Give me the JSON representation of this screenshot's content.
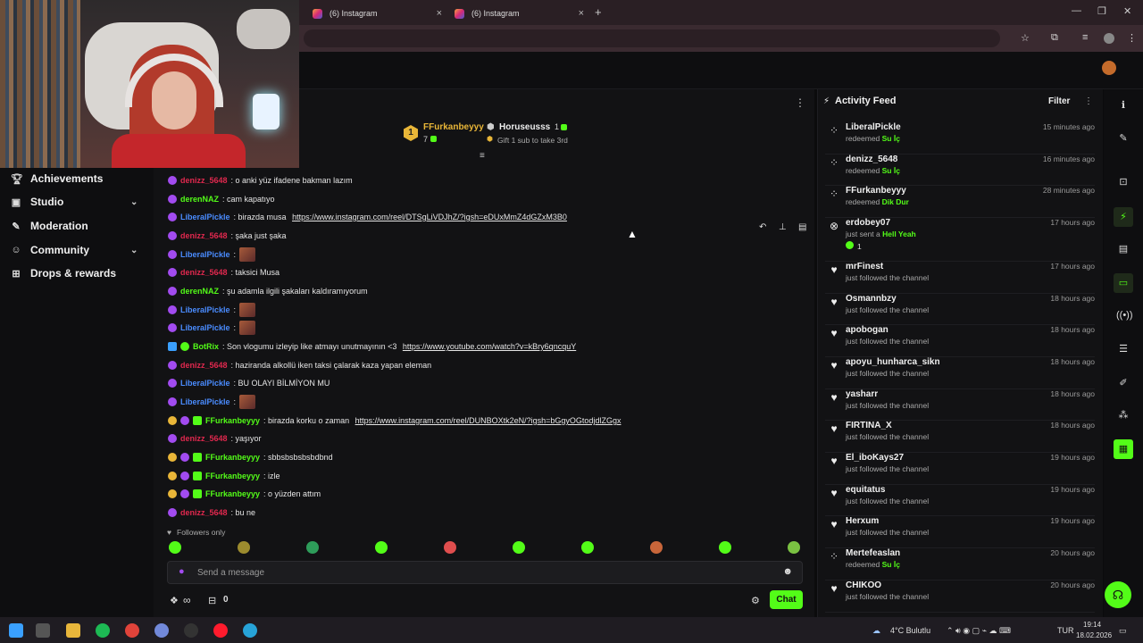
{
  "browser": {
    "tabs": [
      {
        "label": "(6) Instagram"
      },
      {
        "label": "(6) Instagram"
      }
    ],
    "tab_close": "×",
    "new_tab": "+"
  },
  "nav": {
    "items": [
      {
        "label": "Achievements",
        "icon": "trophy-icon"
      },
      {
        "label": "Studio",
        "icon": "studio-icon"
      },
      {
        "label": "Moderation",
        "icon": "wrench-icon"
      },
      {
        "label": "Community",
        "icon": "community-icon"
      },
      {
        "label": "Drops & rewards",
        "icon": "gift-icon"
      }
    ]
  },
  "leaderboard": {
    "rank": "1",
    "first_user": "FFurkanbeyyy",
    "first_count": "7",
    "second_user": "Horuseusss",
    "second_count": "1",
    "gift_text": "Gift 1 sub to take 3rd"
  },
  "chat": {
    "messages": [
      {
        "user": "denizz_5648",
        "text": ": o anki yüz ifadene bakman lazım",
        "color": "#e0284e"
      },
      {
        "user": "derenNAZ",
        "text": ": cam kapatıyo",
        "color": "#53fc18"
      },
      {
        "user": "LiberalPickle",
        "text": ": birazda musa ",
        "link": "https://www.instagram.com/reel/DTSgLiVDJhZ/?igsh=eDUxMmZ4dGZxM3B0",
        "color": "#4a8cff"
      },
      {
        "user": "denizz_5648",
        "text": ": şaka just şaka",
        "color": "#e0284e"
      },
      {
        "user": "LiberalPickle",
        "text": ":",
        "color": "#4a8cff"
      },
      {
        "user": "denizz_5648",
        "text": ": taksici Musa",
        "color": "#e0284e"
      },
      {
        "user": "derenNAZ",
        "text": ": şu adamla ilgili şakaları kaldıramıyorum",
        "color": "#53fc18"
      },
      {
        "user": "LiberalPickle",
        "text": ":",
        "color": "#4a8cff"
      },
      {
        "user": "LiberalPickle",
        "text": ":",
        "color": "#4a8cff"
      },
      {
        "user": "BotRix",
        "text": ": Son vlogumu izleyip like atmayı unutmayının <3 ",
        "link": "https://www.youtube.com/watch?v=kBry6qncquY",
        "color": "#53fc18"
      },
      {
        "user": "denizz_5648",
        "text": ": haziranda alkollü iken taksi çalarak kaza yapan eleman",
        "color": "#e0284e"
      },
      {
        "user": "LiberalPickle",
        "text": ": BU OLAYI BİLMİYON MU",
        "color": "#4a8cff"
      },
      {
        "user": "LiberalPickle",
        "text": ":",
        "color": "#4a8cff"
      },
      {
        "user": "FFurkanbeyyy",
        "text": ": birazda korku o zaman ",
        "link": "https://www.instagram.com/reel/DUNBOXtk2eN/?igsh=bGgyOGtodjdlZGgx",
        "color": "#53fc18"
      },
      {
        "user": "denizz_5648",
        "text": ": yaşıyor",
        "color": "#e0284e"
      },
      {
        "user": "FFurkanbeyyy",
        "text": ": sbbsbsbsbsbdbnd",
        "color": "#53fc18"
      },
      {
        "user": "FFurkanbeyyy",
        "text": ": izle",
        "color": "#53fc18"
      },
      {
        "user": "FFurkanbeyyy",
        "text": ": o yüzden attım",
        "color": "#53fc18"
      },
      {
        "user": "denizz_5648",
        "text": ": bu ne",
        "color": "#e0284e"
      }
    ],
    "followers_only": "Followers only",
    "placeholder": "Send a message",
    "points_symbol": "∞",
    "gift_count": "0",
    "chat_button": "Chat"
  },
  "activity": {
    "title": "Activity Feed",
    "filter": "Filter",
    "items": [
      {
        "user": "LiberalPickle",
        "action": "redeemed ",
        "reward": "Su İç",
        "time": "15 minutes ago",
        "icon": "reward-icon"
      },
      {
        "user": "denizz_5648",
        "action": "redeemed ",
        "reward": "Su İç",
        "time": "16 minutes ago",
        "icon": "reward-icon"
      },
      {
        "user": "FFurkanbeyyy",
        "action": "redeemed ",
        "reward": "Dik Dur",
        "time": "28 minutes ago",
        "icon": "reward-icon"
      },
      {
        "user": "erdobey07",
        "action": "just sent a ",
        "reward": "Hell Yeah",
        "extra": "1",
        "time": "17 hours ago",
        "icon": "kick-icon"
      },
      {
        "user": "mrFinest",
        "action": "just followed the channel",
        "time": "17 hours ago",
        "icon": "heart-icon"
      },
      {
        "user": "Osmannbzy",
        "action": "just followed the channel",
        "time": "18 hours ago",
        "icon": "heart-icon"
      },
      {
        "user": "apobogan",
        "action": "just followed the channel",
        "time": "18 hours ago",
        "icon": "heart-icon"
      },
      {
        "user": "apoyu_hunharca_sikn",
        "action": "just followed the channel",
        "time": "18 hours ago",
        "icon": "heart-icon"
      },
      {
        "user": "yasharr",
        "action": "just followed the channel",
        "time": "18 hours ago",
        "icon": "heart-icon"
      },
      {
        "user": "FIRTINA_X",
        "action": "just followed the channel",
        "time": "18 hours ago",
        "icon": "heart-icon"
      },
      {
        "user": "El_iboKays27",
        "action": "just followed the channel",
        "time": "19 hours ago",
        "icon": "heart-icon"
      },
      {
        "user": "equitatus",
        "action": "just followed the channel",
        "time": "19 hours ago",
        "icon": "heart-icon"
      },
      {
        "user": "Herxum",
        "action": "just followed the channel",
        "time": "19 hours ago",
        "icon": "heart-icon"
      },
      {
        "user": "Mertefeaslan",
        "action": "redeemed ",
        "reward": "Su İç",
        "time": "20 hours ago",
        "icon": "reward-icon"
      },
      {
        "user": "CHIKOO",
        "action": "just followed the channel",
        "time": "20 hours ago",
        "icon": "heart-icon"
      }
    ]
  },
  "taskbar": {
    "weather": "4°C Bulutlu",
    "lang": "TUR",
    "time": "19:14",
    "date": "18.02.2026"
  },
  "colors": {
    "accent": "#53fc18",
    "background": "#121214"
  }
}
